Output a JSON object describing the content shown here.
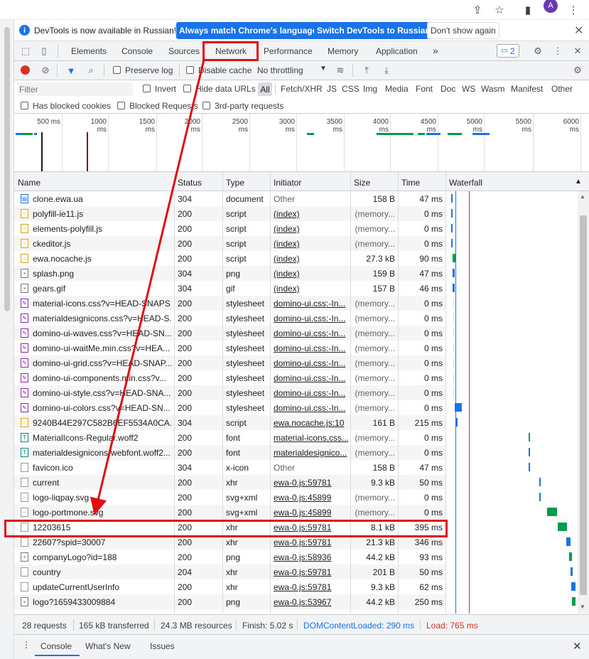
{
  "infobar": {
    "message": "DevTools is now available in Russian!",
    "btn_match": "Always match Chrome's language",
    "btn_switch": "Switch DevTools to Russian",
    "btn_dont_show": "Don't show again",
    "close": "✕"
  },
  "chrome": {
    "avatar_letter": "A"
  },
  "tabs": [
    "Elements",
    "Console",
    "Sources",
    "Network",
    "Performance",
    "Memory",
    "Application"
  ],
  "tabs_more": "»",
  "issues_count": "2",
  "toolbar": {
    "preserve_log": "Preserve log",
    "disable_cache": "Disable cache",
    "throttling": "No throttling"
  },
  "filter": {
    "placeholder": "Filter",
    "invert": "Invert",
    "hide_data_urls": "Hide data URLs",
    "types": [
      "All",
      "Fetch/XHR",
      "JS",
      "CSS",
      "Img",
      "Media",
      "Font",
      "Doc",
      "WS",
      "Wasm",
      "Manifest",
      "Other"
    ],
    "has_blocked_cookies": "Has blocked cookies",
    "blocked_requests": "Blocked Requests",
    "third_party": "3rd-party requests"
  },
  "overview": {
    "ticks": [
      "500 ms",
      "1000 ms",
      "1500 ms",
      "2000 ms",
      "2500 ms",
      "3000 ms",
      "3500 ms",
      "4000 ms",
      "4500 ms",
      "5000 ms",
      "5500 ms",
      "6000 ms"
    ]
  },
  "table": {
    "headers": {
      "name": "Name",
      "status": "Status",
      "type": "Type",
      "initiator": "Initiator",
      "size": "Size",
      "time": "Time",
      "waterfall": "Waterfall"
    },
    "rows": [
      {
        "name": "clone.ewa.ua",
        "status": "304",
        "type": "document",
        "initiator": "Other",
        "size": "158 B",
        "time": "47 ms"
      },
      {
        "name": "polyfill-ie11.js",
        "status": "200",
        "type": "script",
        "initiator": "(index)",
        "size": "(memory...",
        "time": "0 ms"
      },
      {
        "name": "elements-polyfill.js",
        "status": "200",
        "type": "script",
        "initiator": "(index)",
        "size": "(memory...",
        "time": "0 ms"
      },
      {
        "name": "ckeditor.js",
        "status": "200",
        "type": "script",
        "initiator": "(index)",
        "size": "(memory...",
        "time": "0 ms"
      },
      {
        "name": "ewa.nocache.js",
        "status": "200",
        "type": "script",
        "initiator": "(index)",
        "size": "27.3 kB",
        "time": "90 ms"
      },
      {
        "name": "splash.png",
        "status": "304",
        "type": "png",
        "initiator": "(index)",
        "size": "159 B",
        "time": "47 ms"
      },
      {
        "name": "gears.gif",
        "status": "304",
        "type": "gif",
        "initiator": "(index)",
        "size": "157 B",
        "time": "46 ms"
      },
      {
        "name": "material-icons.css?v=HEAD-SNAPS...",
        "status": "200",
        "type": "stylesheet",
        "initiator": "domino-ui.css:-In...",
        "size": "(memory...",
        "time": "0 ms"
      },
      {
        "name": "materialdesignicons.css?v=HEAD-S...",
        "status": "200",
        "type": "stylesheet",
        "initiator": "domino-ui.css:-In...",
        "size": "(memory...",
        "time": "0 ms"
      },
      {
        "name": "domino-ui-waves.css?v=HEAD-SN...",
        "status": "200",
        "type": "stylesheet",
        "initiator": "domino-ui.css:-In...",
        "size": "(memory...",
        "time": "0 ms"
      },
      {
        "name": "domino-ui-waitMe.min.css?v=HEA...",
        "status": "200",
        "type": "stylesheet",
        "initiator": "domino-ui.css:-In...",
        "size": "(memory...",
        "time": "0 ms"
      },
      {
        "name": "domino-ui-grid.css?v=HEAD-SNAP...",
        "status": "200",
        "type": "stylesheet",
        "initiator": "domino-ui.css:-In...",
        "size": "(memory...",
        "time": "0 ms"
      },
      {
        "name": "domino-ui-components.min.css?v...",
        "status": "200",
        "type": "stylesheet",
        "initiator": "domino-ui.css:-In...",
        "size": "(memory...",
        "time": "0 ms"
      },
      {
        "name": "domino-ui-style.css?v=HEAD-SNA...",
        "status": "200",
        "type": "stylesheet",
        "initiator": "domino-ui.css:-In...",
        "size": "(memory...",
        "time": "0 ms"
      },
      {
        "name": "domino-ui-colors.css?v=HEAD-SN...",
        "status": "200",
        "type": "stylesheet",
        "initiator": "domino-ui.css:-In...",
        "size": "(memory...",
        "time": "0 ms"
      },
      {
        "name": "9240B44E297C582B6EF5534A0CA...",
        "status": "304",
        "type": "script",
        "initiator": "ewa.nocache.js:10",
        "size": "161 B",
        "time": "215 ms"
      },
      {
        "name": "MaterialIcons-Regular.woff2",
        "status": "200",
        "type": "font",
        "initiator": "material-icons.css...",
        "size": "(memory...",
        "time": "0 ms"
      },
      {
        "name": "materialdesignicons-webfont.woff2...",
        "status": "200",
        "type": "font",
        "initiator": "materialdesignico...",
        "size": "(memory...",
        "time": "0 ms"
      },
      {
        "name": "favicon.ico",
        "status": "304",
        "type": "x-icon",
        "initiator": "Other",
        "size": "158 B",
        "time": "47 ms"
      },
      {
        "name": "current",
        "status": "200",
        "type": "xhr",
        "initiator": "ewa-0.js:59781",
        "size": "9.3 kB",
        "time": "50 ms"
      },
      {
        "name": "logo-liqpay.svg",
        "status": "200",
        "type": "svg+xml",
        "initiator": "ewa-0.js:45899",
        "size": "(memory...",
        "time": "0 ms"
      },
      {
        "name": "logo-portmone.svg",
        "status": "200",
        "type": "svg+xml",
        "initiator": "ewa-0.js:45899",
        "size": "(memory...",
        "time": "0 ms"
      },
      {
        "name": "12203615",
        "status": "200",
        "type": "xhr",
        "initiator": "ewa-0.js:59781",
        "size": "8.1 kB",
        "time": "395 ms"
      },
      {
        "name": "22607?spid=30007",
        "status": "200",
        "type": "xhr",
        "initiator": "ewa-0.js:59781",
        "size": "21.3 kB",
        "time": "346 ms"
      },
      {
        "name": "companyLogo?id=188",
        "status": "200",
        "type": "png",
        "initiator": "ewa-0.js:58936",
        "size": "44.2 kB",
        "time": "93 ms"
      },
      {
        "name": "country",
        "status": "204",
        "type": "xhr",
        "initiator": "ewa-0.js:59781",
        "size": "201 B",
        "time": "50 ms"
      },
      {
        "name": "updateCurrentUserInfo",
        "status": "200",
        "type": "xhr",
        "initiator": "ewa-0.js:59781",
        "size": "9.3 kB",
        "time": "62 ms"
      },
      {
        "name": "logo?1659433009884",
        "status": "200",
        "type": "png",
        "initiator": "ewa-0.js:53967",
        "size": "44.2 kB",
        "time": "250 ms"
      }
    ]
  },
  "status": {
    "requests": "28 requests",
    "transferred": "165 kB transferred",
    "resources": "24.3 MB resources",
    "finish": "Finish: 5.02 s",
    "dcl": "DOMContentLoaded: 290 ms",
    "load": "Load: 765 ms"
  },
  "drawer": {
    "tabs": [
      "Console",
      "What's New",
      "Issues"
    ]
  },
  "colors": {
    "accent": "#1a73e8",
    "annotation": "#e01010",
    "dcl": "#1a73e8",
    "load": "#d93025"
  }
}
